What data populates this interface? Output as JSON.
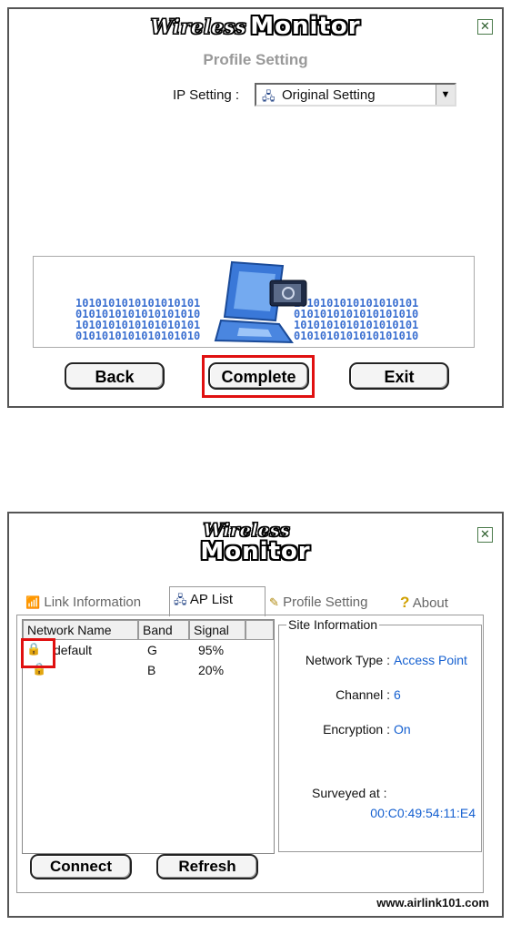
{
  "window1": {
    "logo_wireless": "Wireless",
    "logo_monitor": "Monitor",
    "heading": "Profile Setting",
    "ip_label": "IP Setting :",
    "ip_value": "Original Setting",
    "binary_rows": [
      "1010101010101010101",
      "0101010101010101010",
      "1010101010101010101",
      "0101010101010101010"
    ],
    "back_label": "Back",
    "complete_label": "Complete",
    "exit_label": "Exit"
  },
  "window2": {
    "logo_wireless": "Wireless",
    "logo_monitor": "Monitor",
    "tabs": [
      {
        "label": "Link Information",
        "icon": "network-link-icon"
      },
      {
        "label": "AP List",
        "icon": "computer-network-icon"
      },
      {
        "label": "Profile Setting",
        "icon": "pencil-icon"
      },
      {
        "label": "About",
        "icon": "question-icon"
      }
    ],
    "table": {
      "headers": [
        "Network Name",
        "Band",
        "Signal"
      ],
      "rows": [
        {
          "name": "default",
          "band": "G",
          "signal": "95%"
        },
        {
          "name": "",
          "band": "B",
          "signal": "20%"
        }
      ]
    },
    "site_info": {
      "legend": "Site Information",
      "network_type_label": "Network Type :",
      "network_type_value": "Access Point",
      "channel_label": "Channel :",
      "channel_value": "6",
      "encryption_label": "Encryption :",
      "encryption_value": "On",
      "surveyed_label": "Surveyed at :",
      "surveyed_value": "00:C0:49:54:11:E4"
    },
    "connect_label": "Connect",
    "refresh_label": "Refresh",
    "footer_url": "www.airlink101.com"
  },
  "colors": {
    "highlight": "#e01010",
    "value_blue": "#1560d0",
    "binary_blue": "#3a6fd0"
  }
}
